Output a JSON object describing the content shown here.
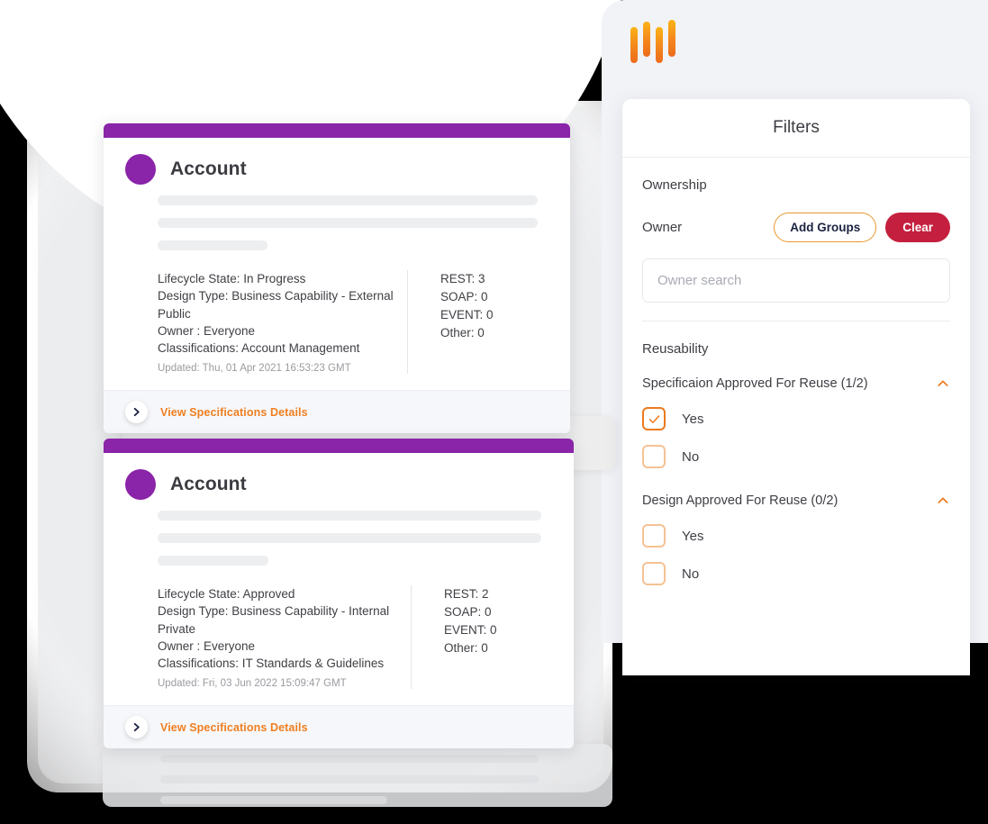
{
  "brand": {
    "logo_name": "logo-bars-icon",
    "logo_bars": 4,
    "accent_orange": "#ef7f21",
    "accent_purple": "#8a24a8",
    "accent_lime": "#c7d61e",
    "accent_crimson": "#c41f3e"
  },
  "cards": [
    {
      "title": "Account",
      "badge_icon": "approved-check-icon",
      "meta": [
        "Lifecycle State: In Progress",
        "Design Type: Business Capability - External Public",
        "Owner : Everyone",
        "Classifications: Account Management"
      ],
      "updated": "Updated: Thu, 01 Apr 2021 16:53:23 GMT",
      "counts": [
        "REST: 3",
        "SOAP: 0",
        "EVENT: 0",
        "Other: 0"
      ],
      "footer_link": "View Specifications Details",
      "footer_icon": "chevron-right-icon"
    },
    {
      "title": "Account",
      "badge_icon": "approved-check-icon",
      "meta": [
        "Lifecycle State: Approved",
        "Design Type: Business Capability - Internal Private",
        "Owner : Everyone",
        "Classifications: IT Standards & Guidelines"
      ],
      "updated": "Updated: Fri, 03 Jun 2022 15:09:47 GMT",
      "counts": [
        "REST: 2",
        "SOAP: 0",
        "EVENT: 0",
        "Other: 0"
      ],
      "footer_link": "View Specifications Details",
      "footer_icon": "chevron-right-icon"
    }
  ],
  "filters": {
    "title": "Filters",
    "ownership": {
      "section_label": "Ownership",
      "owner_label": "Owner",
      "add_groups_label": "Add Groups",
      "clear_label": "Clear",
      "search_placeholder": "Owner search",
      "search_value": ""
    },
    "reusability": {
      "section_label": "Reusability",
      "groups": [
        {
          "title": "Specificaion Approved For Reuse (1/2)",
          "expanded": true,
          "caret_icon": "chevron-up-icon",
          "options": [
            {
              "label": "Yes",
              "checked": true
            },
            {
              "label": "No",
              "checked": false
            }
          ]
        },
        {
          "title": "Design Approved For Reuse (0/2)",
          "expanded": true,
          "caret_icon": "chevron-up-icon",
          "options": [
            {
              "label": "Yes",
              "checked": false
            },
            {
              "label": "No",
              "checked": false
            }
          ]
        }
      ]
    }
  }
}
